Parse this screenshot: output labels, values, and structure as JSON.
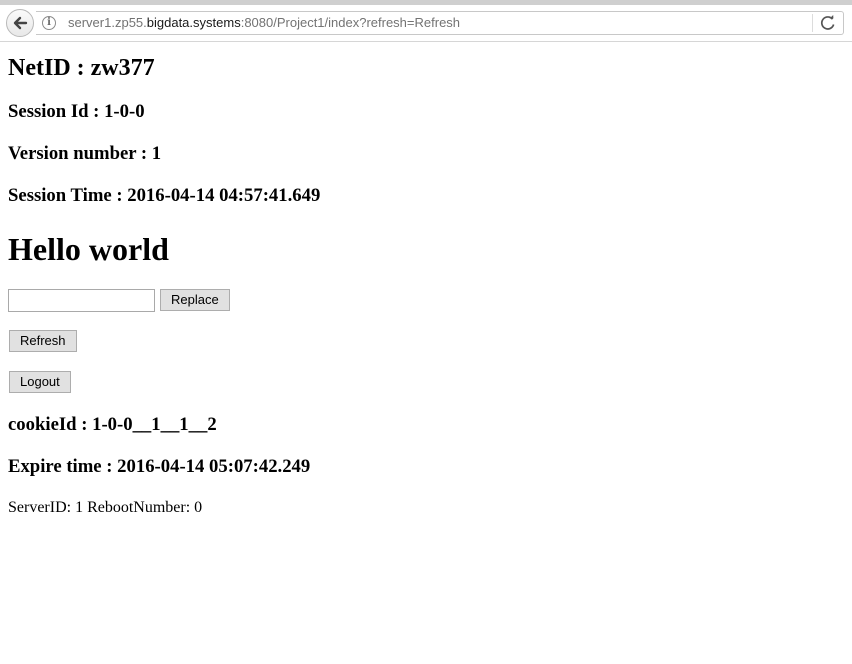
{
  "browser": {
    "url_prefix": "server1.zp55.",
    "url_host": "bigdata.systems",
    "url_suffix": ":8080/Project1/index?refresh=Refresh",
    "info_icon_glyph": "i",
    "icons": [
      "back-arrow-icon",
      "info-icon",
      "reload-icon"
    ]
  },
  "page": {
    "netid": "NetID : zw377",
    "session_id": "Session Id : 1-0-0",
    "version_number": "Version number : 1",
    "session_time": "Session Time : 2016-04-14 04:57:41.649",
    "message": "Hello world",
    "replace_input_value": "",
    "replace_button": "Replace",
    "refresh_button": "Refresh",
    "logout_button": "Logout",
    "cookie_id": "cookieId : 1-0-0__1__1__2",
    "expire_time": "Expire time : 2016-04-14 05:07:42.249",
    "server_info": "ServerID: 1 RebootNumber: 0"
  }
}
